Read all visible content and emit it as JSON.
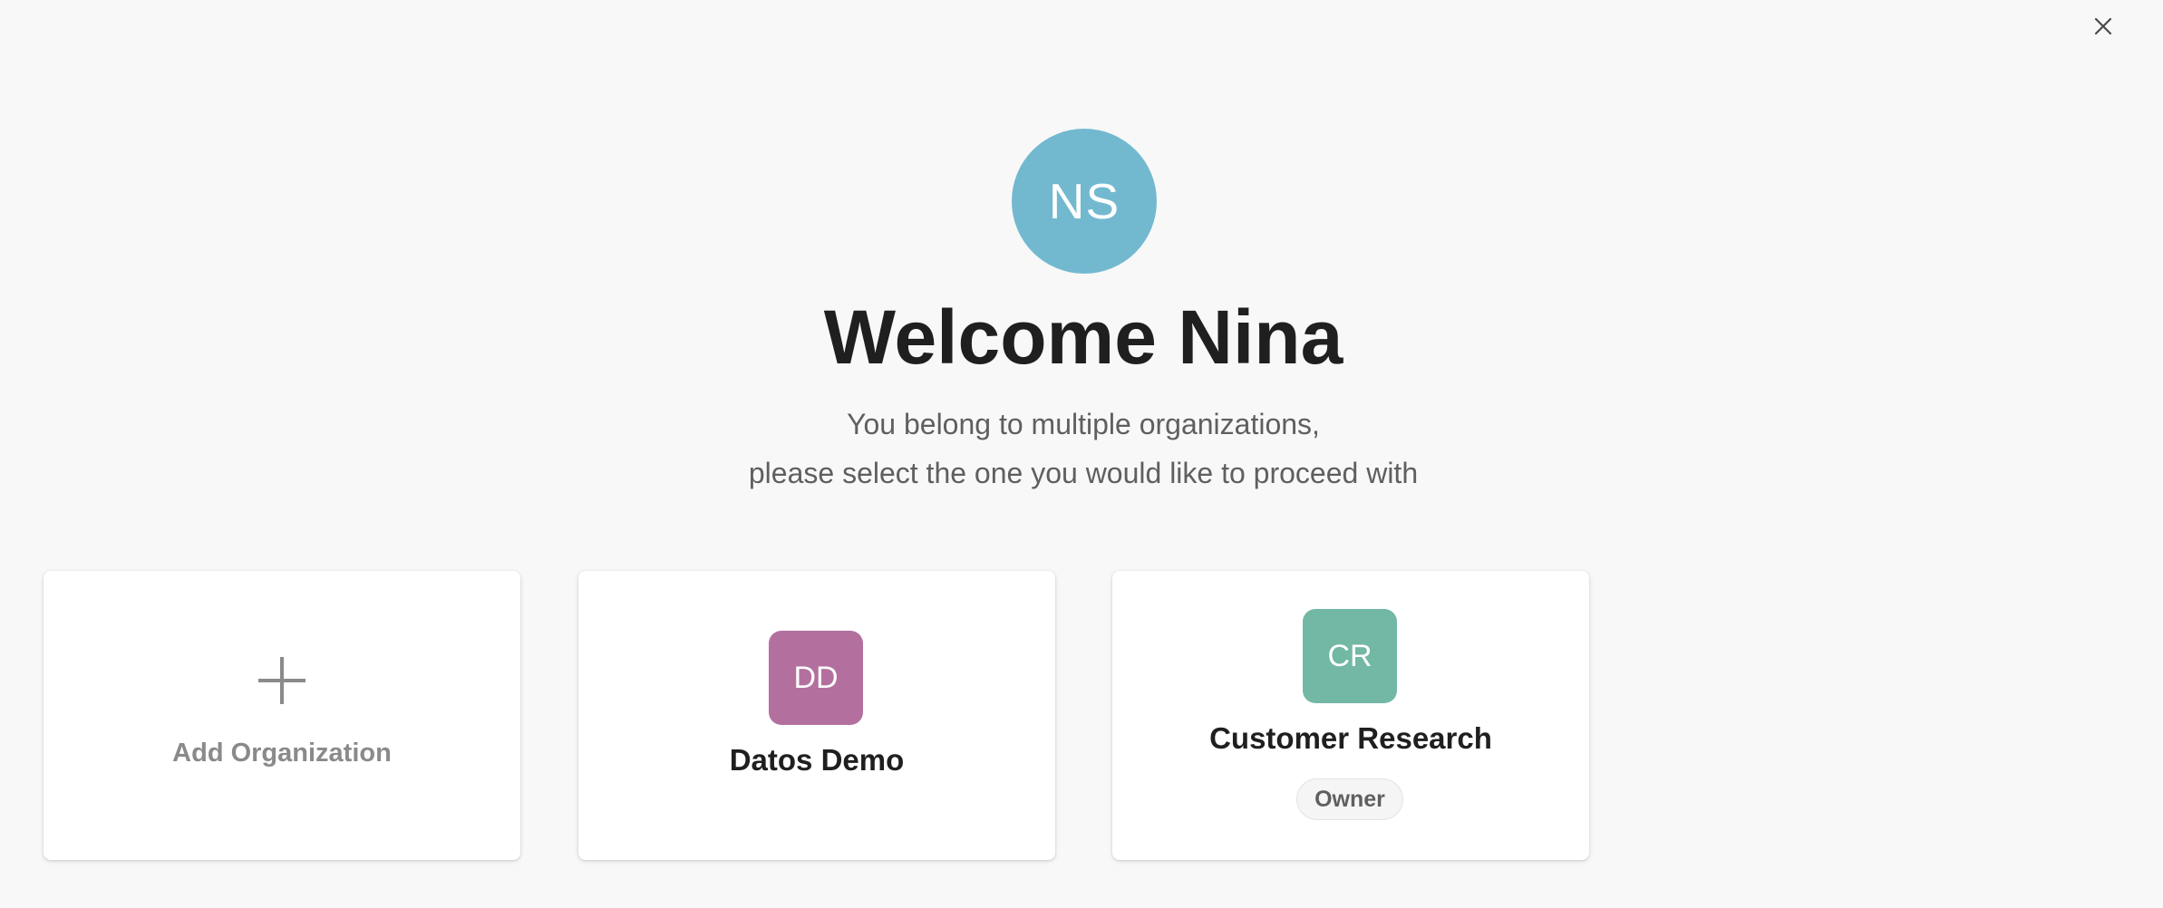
{
  "header": {
    "close_icon": "close-icon"
  },
  "user": {
    "initials": "NS",
    "avatar_color": "#72b9d0"
  },
  "welcome": {
    "title": "Welcome Nina",
    "subtitle_line1": "You belong to multiple organizations,",
    "subtitle_line2": "please select the one you would like to proceed with"
  },
  "add_card": {
    "icon": "plus-icon",
    "label": "Add Organization"
  },
  "organizations": [
    {
      "initials": "DD",
      "name": "Datos Demo",
      "color": "#b3709f"
    },
    {
      "initials": "CR",
      "name": "Customer Research",
      "color": "#72b8a5",
      "role": "Owner"
    }
  ]
}
